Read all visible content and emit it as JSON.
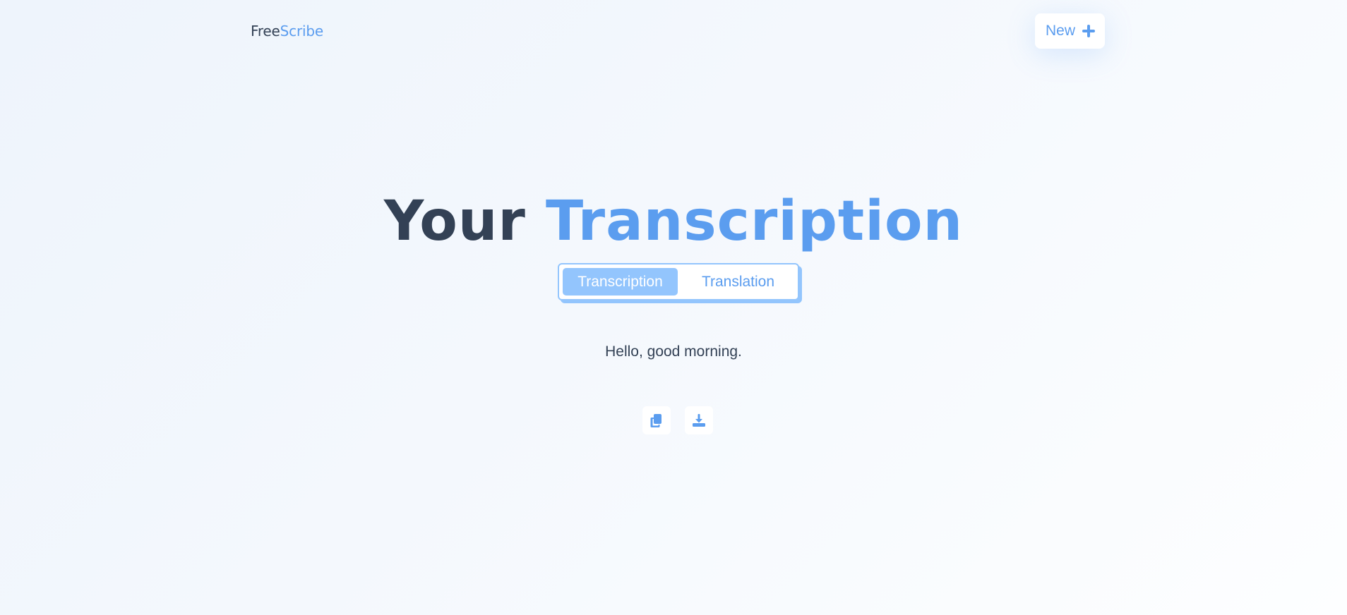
{
  "header": {
    "logo_part1": "Free",
    "logo_part2": "Scribe",
    "new_button_label": "New",
    "new_button_icon": "plus-icon"
  },
  "main": {
    "title_part1": "Your",
    "title_part2": "Transcription",
    "tabs": [
      {
        "label": "Transcription",
        "active": true
      },
      {
        "label": "Translation",
        "active": false
      }
    ],
    "output_text": "Hello, good morning.",
    "actions": [
      {
        "icon": "copy-icon"
      },
      {
        "icon": "download-icon"
      }
    ]
  },
  "colors": {
    "accent": "#5b9def",
    "accent_light": "#93c5fd",
    "text_dark": "#334155",
    "background": "#f1f6fd"
  }
}
